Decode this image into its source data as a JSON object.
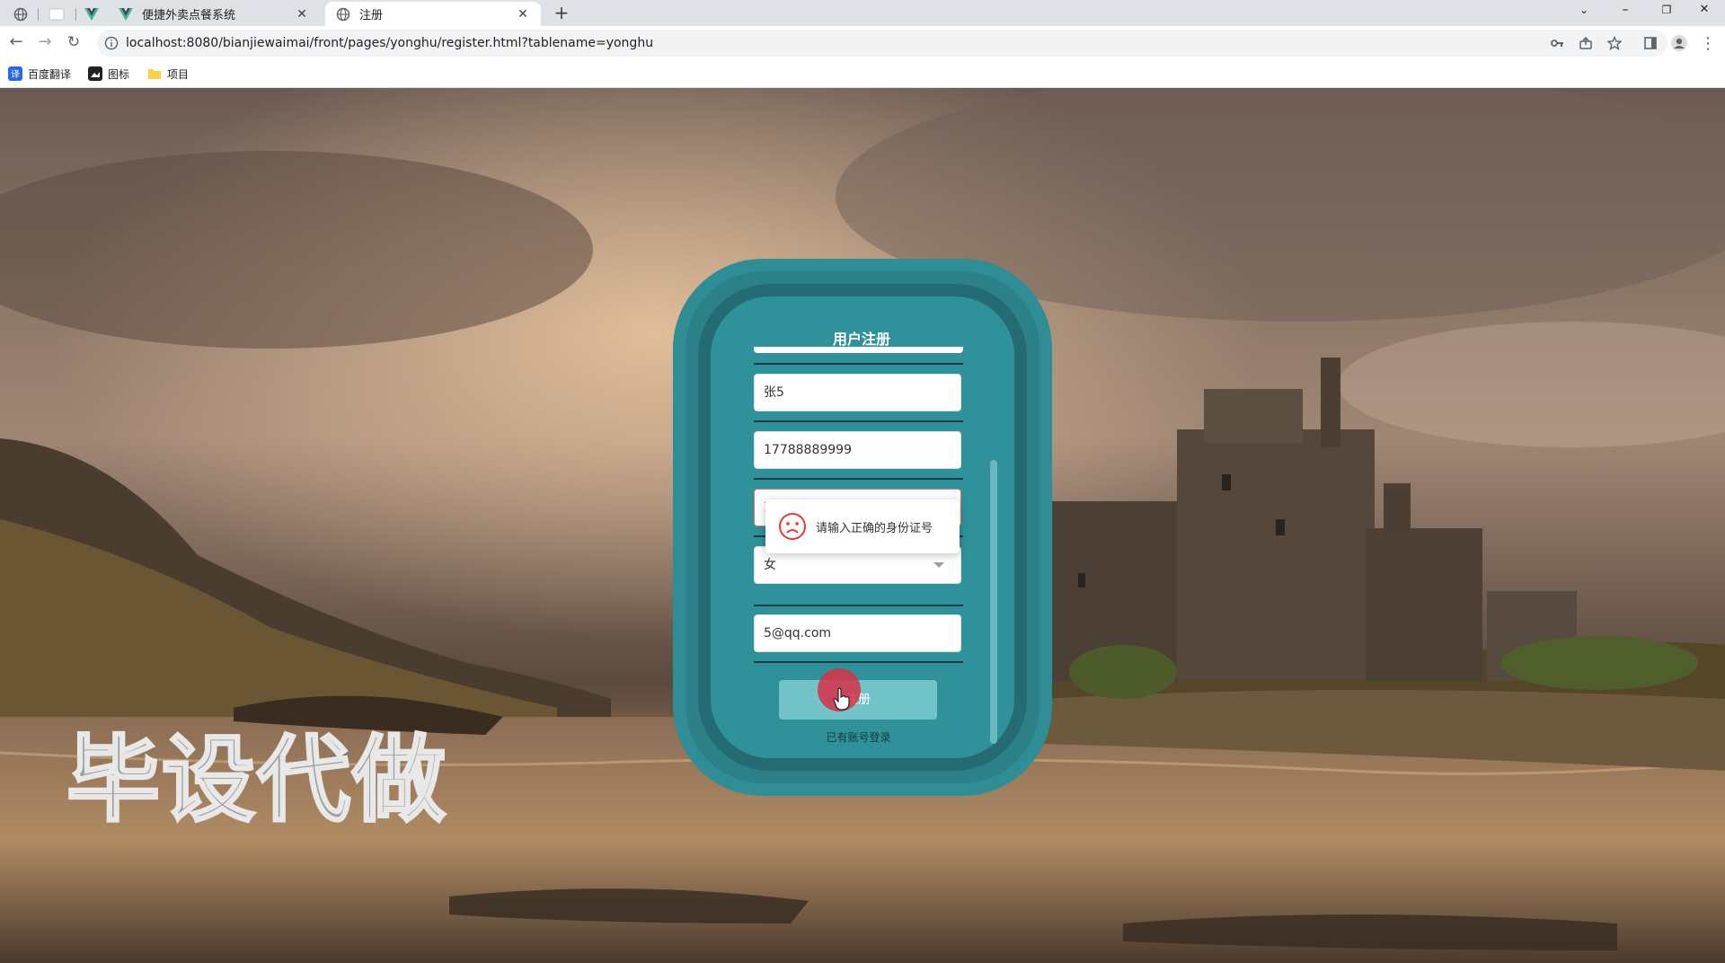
{
  "browser": {
    "tabs": [
      {
        "title": "便捷外卖点餐系统"
      },
      {
        "title": "注册"
      }
    ],
    "url": "localhost:8080/bianjiewaimai/front/pages/yonghu/register.html?tablename=yonghu",
    "bookmarks": [
      {
        "label": "百度翻译"
      },
      {
        "label": "图标"
      },
      {
        "label": "项目"
      }
    ],
    "window_controls": {
      "minimize": "–",
      "restore": "❐",
      "close": "✕"
    }
  },
  "form": {
    "title": "用户注册",
    "fields": {
      "name": {
        "value": "张5"
      },
      "phone": {
        "value": "17788889999"
      },
      "idcard": {
        "value": "1"
      },
      "gender": {
        "value": "女"
      },
      "email": {
        "value": "5@qq.com"
      }
    },
    "submit_label": "注册",
    "login_link": "已有账号登录",
    "error_toast": "请输入正确的身份证号"
  },
  "watermark": "毕设代做",
  "colors": {
    "card": "#2f9199",
    "accent": "#72c4c9",
    "error": "#e53935"
  }
}
